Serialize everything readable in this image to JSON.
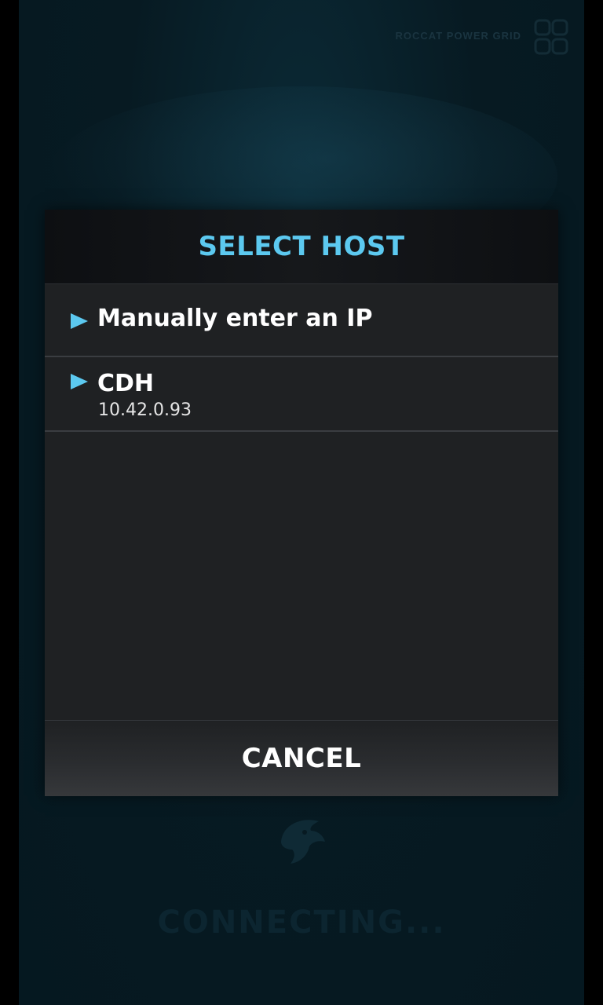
{
  "background": {
    "brand_text": "ROCCAT POWER GRID",
    "status_text": "CONNECTING..."
  },
  "dialog": {
    "title": "SELECT HOST",
    "hosts": [
      {
        "name": "Manually enter an IP",
        "ip": ""
      },
      {
        "name": "CDH",
        "ip": "10.42.0.93"
      }
    ],
    "cancel_label": "CANCEL"
  },
  "colors": {
    "accent": "#5cc9f0",
    "dialog_bg": "#1f2123",
    "text": "#ffffff"
  }
}
